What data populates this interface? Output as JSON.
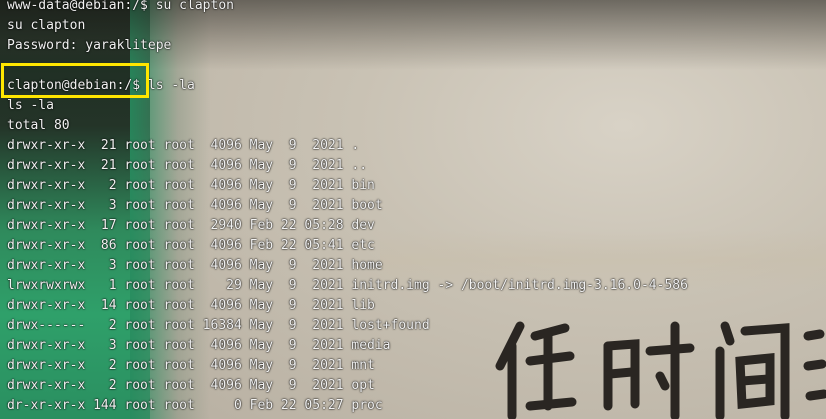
{
  "terminal": {
    "lines": [
      "www-data@debian:/$ su clapton",
      "su clapton",
      "Password: yaraklitepe",
      "",
      "clapton@debian:/$ ls -la",
      "ls -la",
      "total 80",
      "drwxr-xr-x  21 root root  4096 May  9  2021 .",
      "drwxr-xr-x  21 root root  4096 May  9  2021 ..",
      "drwxr-xr-x   2 root root  4096 May  9  2021 bin",
      "drwxr-xr-x   3 root root  4096 May  9  2021 boot",
      "drwxr-xr-x  17 root root  2940 Feb 22 05:28 dev",
      "drwxr-xr-x  86 root root  4096 Feb 22 05:41 etc",
      "drwxr-xr-x   3 root root  4096 May  9  2021 home",
      "lrwxrwxrwx   1 root root    29 May  9  2021 initrd.img -> /boot/initrd.img-3.16.0-4-586",
      "drwxr-xr-x  14 root root  4096 May  9  2021 lib",
      "drwx------   2 root root 16384 May  9  2021 lost+found",
      "drwxr-xr-x   3 root root  4096 May  9  2021 media",
      "drwxr-xr-x   2 root root  4096 May  9  2021 mnt",
      "drwxr-xr-x   2 root root  4096 May  9  2021 opt",
      "dr-xr-xr-x 144 root root     0 Feb 22 05:27 proc"
    ]
  },
  "colors": {
    "text": "#f2f2f2",
    "highlight": "#ffe600"
  }
}
